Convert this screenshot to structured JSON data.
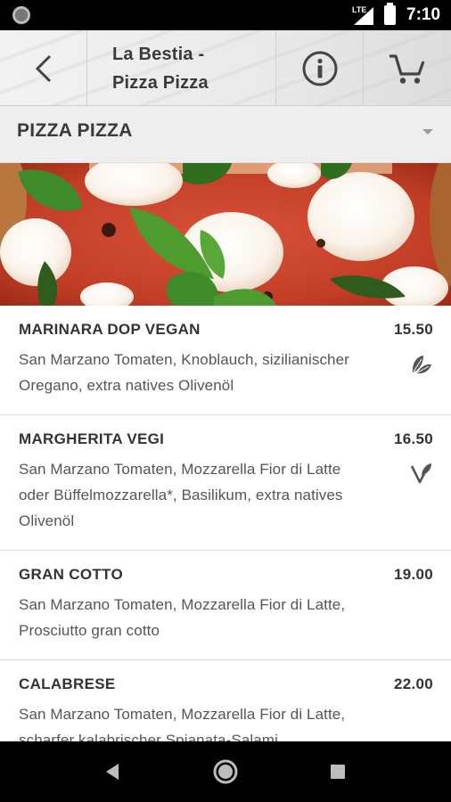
{
  "status_bar": {
    "network": "LTE",
    "time": "7:10"
  },
  "header": {
    "title_line1": "La Bestia -",
    "title_line2": "Pizza Pizza",
    "back_icon": "chevron-left-icon",
    "info_icon": "info-icon",
    "cart_icon": "cart-icon"
  },
  "category": {
    "selected": "PIZZA PIZZA"
  },
  "menu": {
    "items": [
      {
        "name": "MARINARA DOP VEGAN",
        "price": "15.50",
        "description": "San Marzano Tomaten, Knoblauch, sizilianischer Oregano, extra natives Olivenöl",
        "badge": "vegan-leaves-icon"
      },
      {
        "name": "MARGHERITA VEGI",
        "price": "16.50",
        "description": "San Marzano Tomaten, Mozzarella Fior di Latte oder Büffelmozzarella*, Basilikum, extra natives Olivenöl",
        "badge": "vegetarian-v-icon"
      },
      {
        "name": "GRAN COTTO",
        "price": "19.00",
        "description": "San Marzano Tomaten, Mozzarella Fior di Latte, Prosciutto gran cotto",
        "badge": ""
      },
      {
        "name": "CALABRESE",
        "price": "22.00",
        "description": "San Marzano Tomaten, Mozzarella Fior di Latte, scharfer kalabrischer Spianata-Salami,",
        "badge": ""
      }
    ]
  },
  "colors": {
    "header_bg": "#eeeeee",
    "text_dark": "#333333",
    "icon_gray": "#555555"
  }
}
